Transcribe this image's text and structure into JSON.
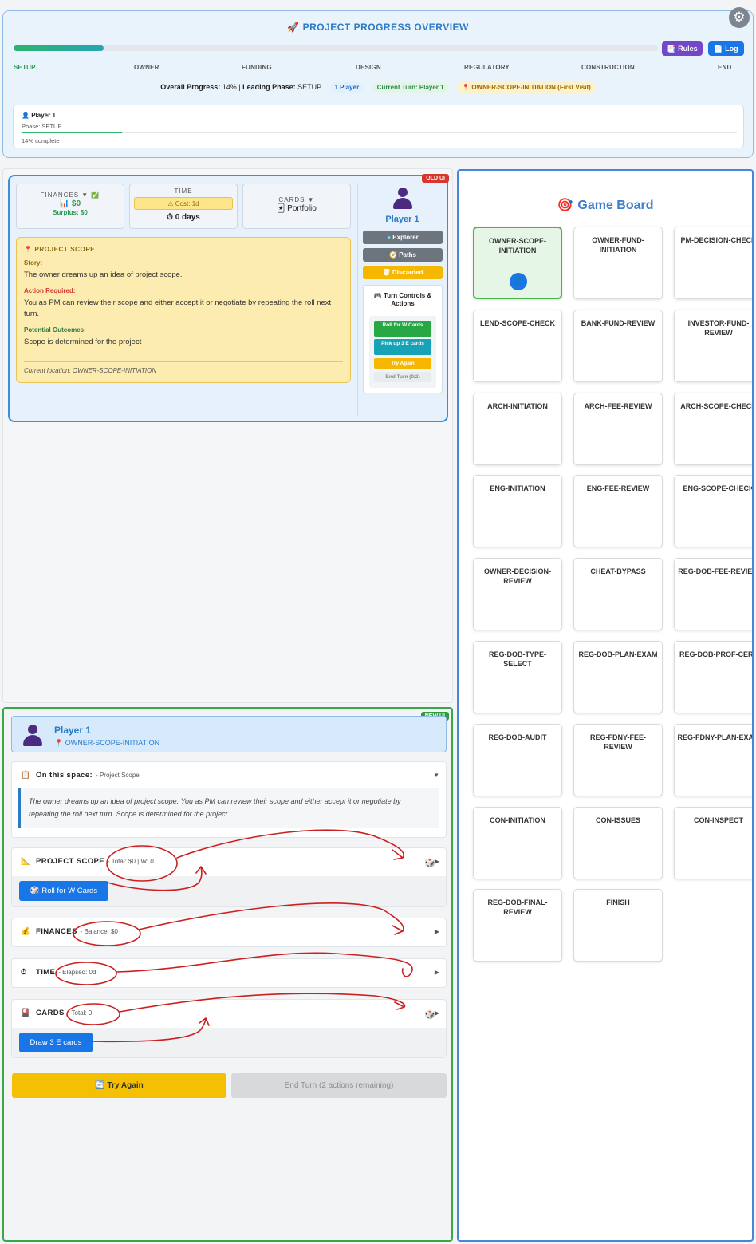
{
  "overview": {
    "title": "PROJECT PROGRESS OVERVIEW",
    "progress_fraction": 0.14,
    "rules_label": "Rules",
    "log_label": "Log",
    "phases": [
      "SETUP",
      "OWNER",
      "FUNDING",
      "DESIGN",
      "REGULATORY",
      "CONSTRUCTION",
      "END"
    ],
    "active_phase": "SETUP",
    "overall_label": "Overall Progress:",
    "overall_value": "14%",
    "leading_label": "Leading Phase:",
    "leading_value": "SETUP",
    "players_pill": "1 Player",
    "turn_pill": "Current Turn: Player 1",
    "location_pill": "OWNER-SCOPE-INITIATION (First Visit)",
    "player_card": {
      "name": "Player 1",
      "phase": "Phase: SETUP",
      "progress_fraction": 0.14,
      "complete": "14% complete"
    }
  },
  "old_ui": {
    "tag": "OLD UI",
    "finances": {
      "heading": "FINANCES ▼",
      "value": "$0",
      "surplus": "Surplus: $0"
    },
    "time": {
      "heading": "TIME",
      "cost": "Cost: 1d",
      "value": "0 days"
    },
    "cards": {
      "heading": "CARDS ▼",
      "value": "Portfolio"
    },
    "scope": {
      "title": "PROJECT SCOPE",
      "story_label": "Story:",
      "story": "The owner dreams up an idea of project scope.",
      "action_label": "Action Required:",
      "action": "You as PM can review their scope and either accept it or negotiate by repeating the roll next turn.",
      "outcome_label": "Potential Outcomes:",
      "outcome": "Scope is determined for the project",
      "location": "Current location: OWNER-SCOPE-INITIATION"
    },
    "side": {
      "player": "Player 1",
      "explorer": "Explorer",
      "paths": "Paths",
      "discarded": "Discarded",
      "turn_title": "Turn Controls & Actions",
      "roll_w": "Roll for W Cards",
      "pickup_e": "Pick up 3 E cards",
      "try_again": "Try Again",
      "end_turn": "End Turn (0/2)"
    }
  },
  "new_ui": {
    "tag": "NEW UI",
    "player": "Player 1",
    "location": "OWNER-SCOPE-INITIATION",
    "space": {
      "label": "On this space:",
      "sub": "- Project Scope",
      "arrow": "▼",
      "description": "The owner dreams up an idea of project scope. You as PM can review their scope and either accept it or negotiate by repeating the roll next turn. Scope is determined for the project"
    },
    "scope": {
      "label": "PROJECT SCOPE",
      "sub": "- Total: $0 | W: 0",
      "button": "Roll for W Cards",
      "arrow": "▶"
    },
    "finances": {
      "label": "FINANCES",
      "sub": "- Balance: $0",
      "arrow": "▶"
    },
    "time": {
      "label": "TIME",
      "sub": "- Elapsed: 0d",
      "arrow": "▶"
    },
    "cards": {
      "label": "CARDS",
      "sub": "- Total: 0",
      "button": "Draw 3 E cards",
      "arrow": "▶"
    },
    "try_again": "Try Again",
    "end_turn": "End Turn (2 actions remaining)"
  },
  "board": {
    "title": "Game Board",
    "spaces": [
      "OWNER-SCOPE-INITIATION",
      "OWNER-FUND-INITIATION",
      "PM-DECISION-CHECK",
      "LEND-SCOPE-CHECK",
      "BANK-FUND-REVIEW",
      "INVESTOR-FUND-REVIEW",
      "ARCH-INITIATION",
      "ARCH-FEE-REVIEW",
      "ARCH-SCOPE-CHECK",
      "ENG-INITIATION",
      "ENG-FEE-REVIEW",
      "ENG-SCOPE-CHECK",
      "OWNER-DECISION-REVIEW",
      "CHEAT-BYPASS",
      "REG-DOB-FEE-REVIEW",
      "REG-DOB-TYPE-SELECT",
      "REG-DOB-PLAN-EXAM",
      "REG-DOB-PROF-CERT",
      "REG-DOB-AUDIT",
      "REG-FDNY-FEE-REVIEW",
      "REG-FDNY-PLAN-EXAM",
      "CON-INITIATION",
      "CON-ISSUES",
      "CON-INSPECT",
      "REG-DOB-FINAL-REVIEW",
      "FINISH"
    ],
    "current_space": "OWNER-SCOPE-INITIATION"
  },
  "colors": {
    "accent": "#2b7bc7",
    "success": "#2fb36c",
    "warning": "#f5c003",
    "danger": "#d9362e",
    "annotation": "#cc1f1f"
  }
}
